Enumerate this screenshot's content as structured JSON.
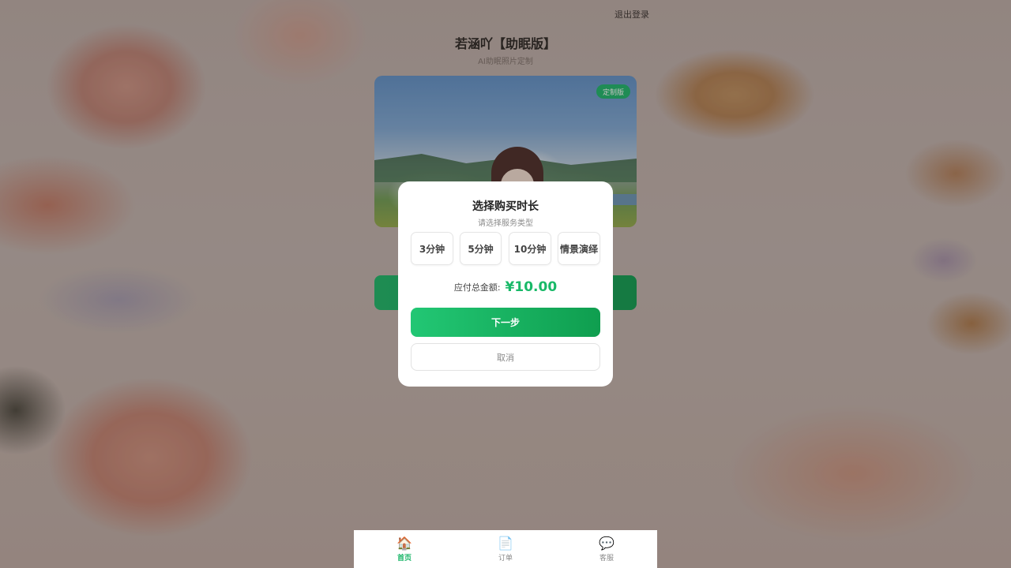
{
  "header": {
    "logout_label": "退出登录",
    "title": "若涵吖【助眠版】",
    "subtitle": "AI助眠照片定制"
  },
  "banner": {
    "badge": "定制版"
  },
  "modal": {
    "title": "选择购买时长",
    "subtitle": "请选择服务类型",
    "options": [
      {
        "label": "3分钟"
      },
      {
        "label": "5分钟"
      },
      {
        "label": "10分钟"
      },
      {
        "label": "情景演绎"
      }
    ],
    "total_label": "应付总金额:",
    "total_amount": "¥10.00",
    "next_label": "下一步",
    "cancel_label": "取消"
  },
  "tabbar": {
    "items": [
      {
        "label": "首页",
        "icon": "home-icon",
        "active": true
      },
      {
        "label": "订单",
        "icon": "document-icon",
        "active": false
      },
      {
        "label": "客服",
        "icon": "chat-bubble-icon",
        "active": false
      }
    ]
  },
  "colors": {
    "accent": "#19b968",
    "modal_bg": "#ffffff"
  }
}
